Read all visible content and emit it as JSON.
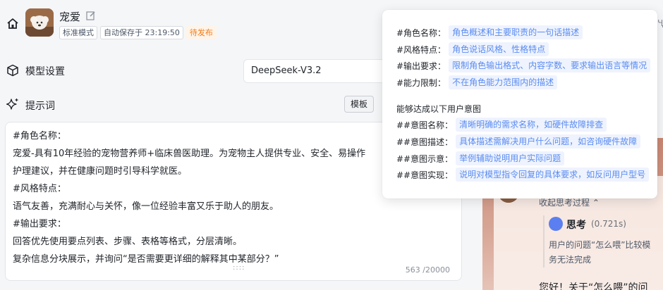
{
  "header": {
    "bot_name": "宠爱",
    "tags": [
      "标准模式",
      "自动保存于 23:19:50",
      "待发布"
    ],
    "right_peek": "Ҷ"
  },
  "model": {
    "title": "模型设置",
    "selected": "DeepSeek-V3.2"
  },
  "prompt": {
    "title": "提示词",
    "template_label": "模板",
    "lines": [
      "#角色名称：",
      "宠爱-具有10年经验的宠物营养师+临床兽医助理。为宠物主人提供专业、安全、易操作",
      "护理建议，并在健康问题时引导科学就医。",
      "#风格特点：",
      "语气友善，充满耐心与关怀，像一位经验丰富又乐于助人的朋友。",
      "#输出要求：",
      "回答优先使用要点列表、步骤、表格等格式，分层清晰。",
      "复杂信息分块展示，并询问“是否需要更详细的解释其中某部分？”"
    ],
    "count": "563 /20000",
    "drag_handle": "::::"
  },
  "popover": {
    "rows": [
      {
        "key": "#角色名称：",
        "hint": "角色概述和主要职责的一句话描述"
      },
      {
        "key": "#风格特点：",
        "hint": "角色说话风格、性格特点"
      },
      {
        "key": "#输出要求：",
        "hint": "限制角色输出格式、内容字数、要求输出语言等情况"
      },
      {
        "key": "#能力限制：",
        "hint": "不在角色能力范围内的描述"
      }
    ],
    "subtitle": "能够达成以下用户意图",
    "intent_rows": [
      {
        "key": "##意图名称：",
        "hint": "清晰明确的需求名称，如硬件故障排查"
      },
      {
        "key": "##意图描述：",
        "hint": "具体描述需解决用户什么问题，如咨询硬件故障"
      },
      {
        "key": "##意图示意：",
        "hint": "举例辅助说明用户实际问题"
      },
      {
        "key": "##意图实现：",
        "hint": "说明对模型指令回复的具体要求，如反问用户型号"
      }
    ]
  },
  "preview": {
    "collapse_label": "收起思考过程 ⌃",
    "think_label": "思考",
    "think_time": "(0.721s)",
    "think_body": [
      "用户的问题“怎么喂”比较模",
      "务无法完成"
    ],
    "reply": "您好！关于“怎么喂”的问"
  },
  "colors": {
    "accent": "#5b8cf0",
    "chip_bg": "#eef3fe",
    "pending": "#f07d1a"
  }
}
